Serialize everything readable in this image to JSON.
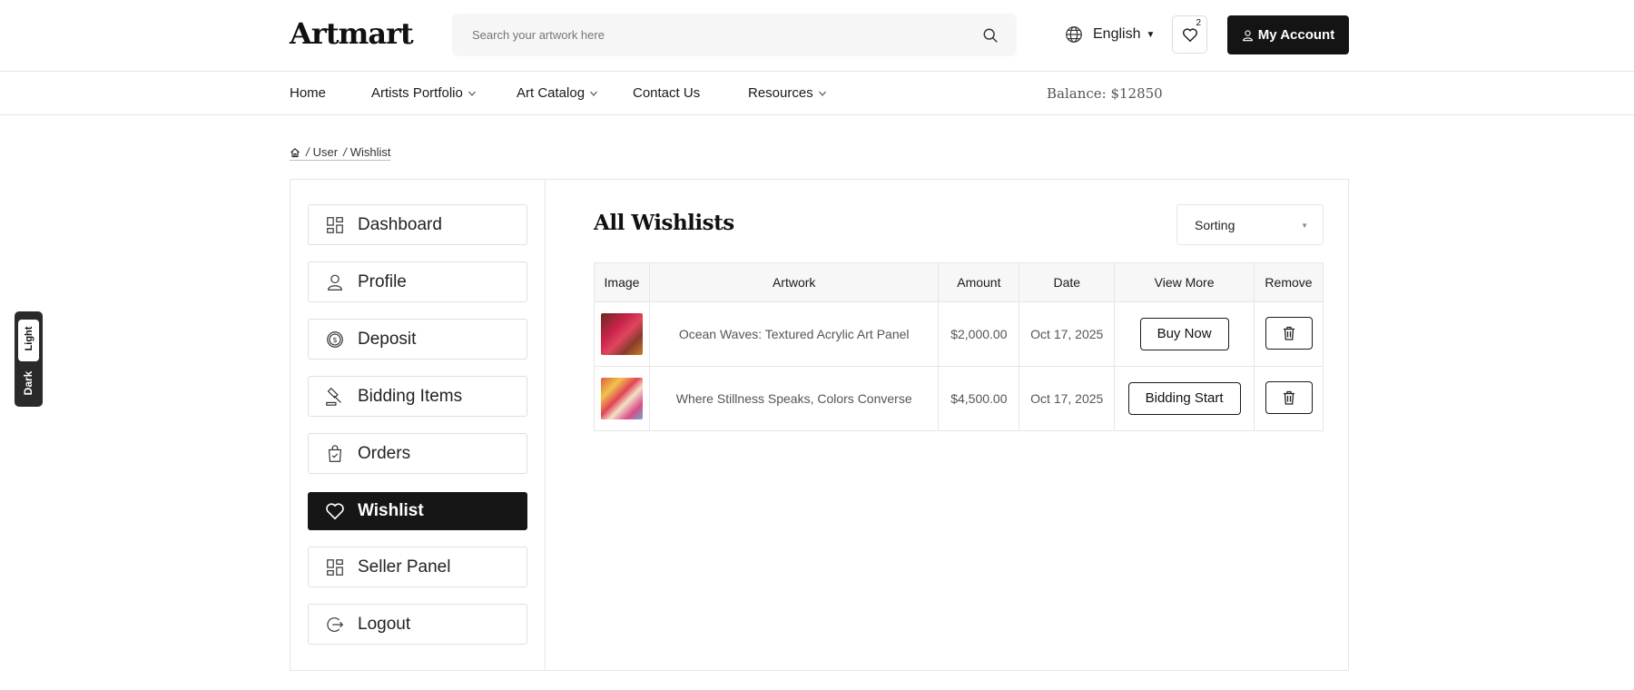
{
  "header": {
    "logo": "Artmart",
    "search_placeholder": "Search your artwork here",
    "language": "English",
    "wishlist_count": "2",
    "account_label": "My Account"
  },
  "nav": {
    "items": [
      {
        "label": "Home"
      },
      {
        "label": "Artists Portfolio"
      },
      {
        "label": "Art Catalog"
      },
      {
        "label": "Contact Us"
      },
      {
        "label": "Resources"
      }
    ],
    "balance": "Balance: $12850"
  },
  "breadcrumb": {
    "items": [
      "User",
      "Wishlist"
    ]
  },
  "theme_toggle": {
    "light": "Light",
    "dark": "Dark"
  },
  "sidebar": {
    "items": [
      {
        "label": "Dashboard",
        "icon": "dashboard-icon"
      },
      {
        "label": "Profile",
        "icon": "user-icon"
      },
      {
        "label": "Deposit",
        "icon": "coin-icon"
      },
      {
        "label": "Bidding Items",
        "icon": "gavel-icon"
      },
      {
        "label": "Orders",
        "icon": "shopping-bag-icon"
      },
      {
        "label": "Wishlist",
        "icon": "heart-icon",
        "active": true
      },
      {
        "label": "Seller Panel",
        "icon": "dashboard-icon"
      },
      {
        "label": "Logout",
        "icon": "logout-icon"
      }
    ]
  },
  "main": {
    "title": "All Wishlists",
    "sort_label": "Sorting",
    "columns": [
      "Image",
      "Artwork",
      "Amount",
      "Date",
      "View More",
      "Remove"
    ],
    "rows": [
      {
        "artwork": "Ocean Waves: Textured Acrylic Art Panel",
        "amount": "$2,000.00",
        "date": "Oct 17, 2025",
        "action": "Buy Now"
      },
      {
        "artwork": "Where Stillness Speaks, Colors Converse",
        "amount": "$4,500.00",
        "date": "Oct 17, 2025",
        "action": "Bidding Start"
      }
    ]
  },
  "colors": {
    "primary": "#141414",
    "border": "#e6e6e6",
    "background": "#ffffff"
  }
}
